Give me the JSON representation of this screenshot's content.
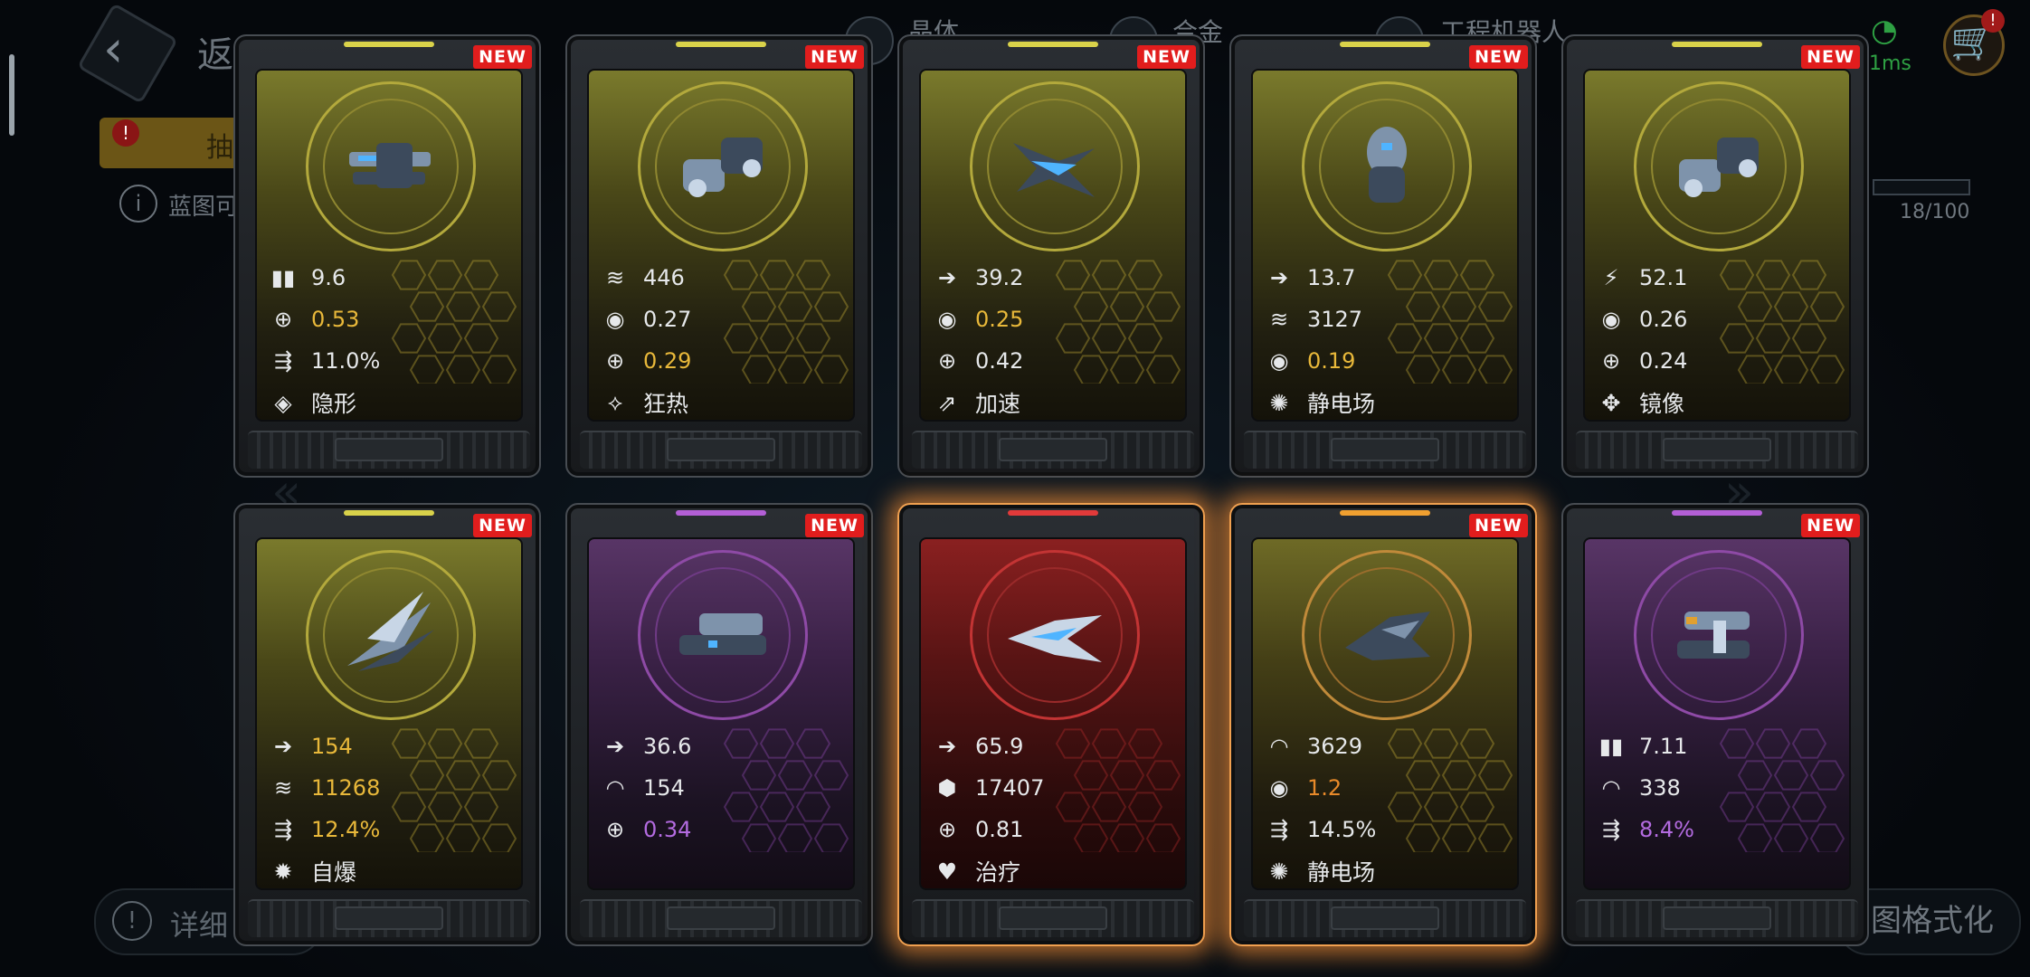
{
  "header": {
    "back_label": "返",
    "resources": [
      "晶体",
      "合金",
      "工程机器人"
    ],
    "ping": "1ms",
    "cart_badge": "!"
  },
  "background": {
    "tab_label": "抽",
    "info_text": "蓝图可",
    "progress": "18/100",
    "detail_label": "详细",
    "format_label": "图格式化"
  },
  "colors": {
    "gold_accent": "#e8b83a",
    "purple_accent": "#b36be0",
    "orange_accent": "#e88a2a",
    "new_badge": "#e11d1d"
  },
  "cards": [
    {
      "rarity": "gold",
      "new": "NEW",
      "ship": "blaster-ship",
      "stats": [
        {
          "icon": "ammo-icon",
          "value": "9.6",
          "tone": "white"
        },
        {
          "icon": "crosshair-icon",
          "value": "0.53",
          "tone": "gold"
        },
        {
          "icon": "missile-icon",
          "value": "11.0%",
          "tone": "white"
        }
      ],
      "ability": {
        "icon": "stealth-icon",
        "label": "隐形"
      }
    },
    {
      "rarity": "gold",
      "new": "NEW",
      "ship": "tank-ship",
      "stats": [
        {
          "icon": "armor-icon",
          "value": "446",
          "tone": "white"
        },
        {
          "icon": "shield-icon",
          "value": "0.27",
          "tone": "white"
        },
        {
          "icon": "crosshair-icon",
          "value": "0.29",
          "tone": "gold"
        }
      ],
      "ability": {
        "icon": "frenzy-icon",
        "label": "狂热"
      }
    },
    {
      "rarity": "gold",
      "new": "NEW",
      "ship": "claw-ship",
      "stats": [
        {
          "icon": "speed-icon",
          "value": "39.2",
          "tone": "white"
        },
        {
          "icon": "shield-icon",
          "value": "0.25",
          "tone": "gold"
        },
        {
          "icon": "crosshair-icon",
          "value": "0.42",
          "tone": "white"
        }
      ],
      "ability": {
        "icon": "boost-icon",
        "label": "加速"
      }
    },
    {
      "rarity": "gold",
      "new": "NEW",
      "ship": "pod-ship",
      "stats": [
        {
          "icon": "speed-icon",
          "value": "13.7",
          "tone": "white"
        },
        {
          "icon": "armor-icon",
          "value": "3127",
          "tone": "white"
        },
        {
          "icon": "shield-icon",
          "value": "0.19",
          "tone": "gold"
        }
      ],
      "ability": {
        "icon": "static-field-icon",
        "label": "静电场"
      }
    },
    {
      "rarity": "gold",
      "new": "NEW",
      "ship": "tank-ship",
      "stats": [
        {
          "icon": "damage-icon",
          "value": "52.1",
          "tone": "white"
        },
        {
          "icon": "shield-icon",
          "value": "0.26",
          "tone": "white"
        },
        {
          "icon": "crosshair-icon",
          "value": "0.24",
          "tone": "white"
        }
      ],
      "ability": {
        "icon": "mirror-icon",
        "label": "镜像"
      }
    },
    {
      "rarity": "gold",
      "new": "NEW",
      "ship": "spike-ship",
      "stats": [
        {
          "icon": "speed-icon",
          "value": "154",
          "tone": "gold"
        },
        {
          "icon": "armor-icon",
          "value": "11268",
          "tone": "gold"
        },
        {
          "icon": "missile-icon",
          "value": "12.4%",
          "tone": "gold"
        }
      ],
      "ability": {
        "icon": "self-destruct-icon",
        "label": "自爆"
      }
    },
    {
      "rarity": "purple",
      "new": "NEW",
      "ship": "cruiser-ship",
      "stats": [
        {
          "icon": "speed-icon",
          "value": "36.6",
          "tone": "white"
        },
        {
          "icon": "hull-icon",
          "value": "154",
          "tone": "white"
        },
        {
          "icon": "crosshair-icon",
          "value": "0.34",
          "tone": "purple"
        }
      ],
      "ability": null
    },
    {
      "rarity": "red",
      "new": "",
      "ship": "arrow-ship",
      "glow": true,
      "stats": [
        {
          "icon": "speed-icon",
          "value": "65.9",
          "tone": "white"
        },
        {
          "icon": "hex-cluster-icon",
          "value": "17407",
          "tone": "white"
        },
        {
          "icon": "crosshair-icon",
          "value": "0.81",
          "tone": "white"
        }
      ],
      "ability": {
        "icon": "heal-icon",
        "label": "治疗"
      }
    },
    {
      "rarity": "orange",
      "new": "NEW",
      "ship": "fighter-ship",
      "glow": true,
      "stats": [
        {
          "icon": "hull-icon",
          "value": "3629",
          "tone": "white"
        },
        {
          "icon": "shield-icon",
          "value": "1.2",
          "tone": "orange"
        },
        {
          "icon": "missile-icon",
          "value": "14.5%",
          "tone": "white"
        }
      ],
      "ability": {
        "icon": "static-field-icon",
        "label": "静电场"
      }
    },
    {
      "rarity": "purple",
      "new": "NEW",
      "ship": "twin-ship",
      "stats": [
        {
          "icon": "ammo-icon",
          "value": "7.11",
          "tone": "white"
        },
        {
          "icon": "hull-icon",
          "value": "338",
          "tone": "white"
        },
        {
          "icon": "missile-icon",
          "value": "8.4%",
          "tone": "purple"
        }
      ],
      "ability": null
    }
  ]
}
